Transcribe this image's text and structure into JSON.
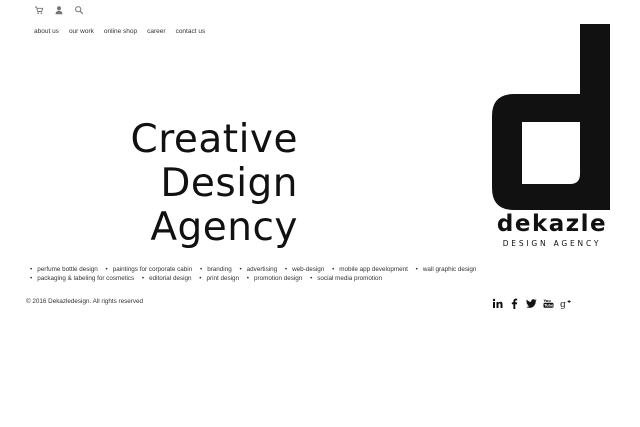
{
  "header": {
    "icons": [
      "cart-icon",
      "user-icon",
      "search-icon"
    ],
    "nav": [
      "about us",
      "our work",
      "online shop",
      "career",
      "contact us"
    ]
  },
  "hero": {
    "line1": "Creative",
    "line2": "Design",
    "line3": "Agency"
  },
  "logo": {
    "wordmark": "dekazle",
    "tagline": "DESIGN AGENCY"
  },
  "services": [
    "perfume bottle design",
    "paintings for corporate cabin",
    "branding",
    "advertising",
    "web-design",
    "mobile app development",
    "wall graphic design",
    "packaging & labeling for cosmetics",
    "editorial design",
    "print design",
    "promotion design",
    "social media promotion"
  ],
  "footer": {
    "copyright": "© 2016 Dekazledesign. All rights reserved",
    "social_icons": [
      "linkedin-icon",
      "facebook-icon",
      "twitter-icon",
      "youtube-icon",
      "google-plus-icon"
    ]
  },
  "colors": {
    "text": "#111111",
    "background": "#ffffff"
  }
}
